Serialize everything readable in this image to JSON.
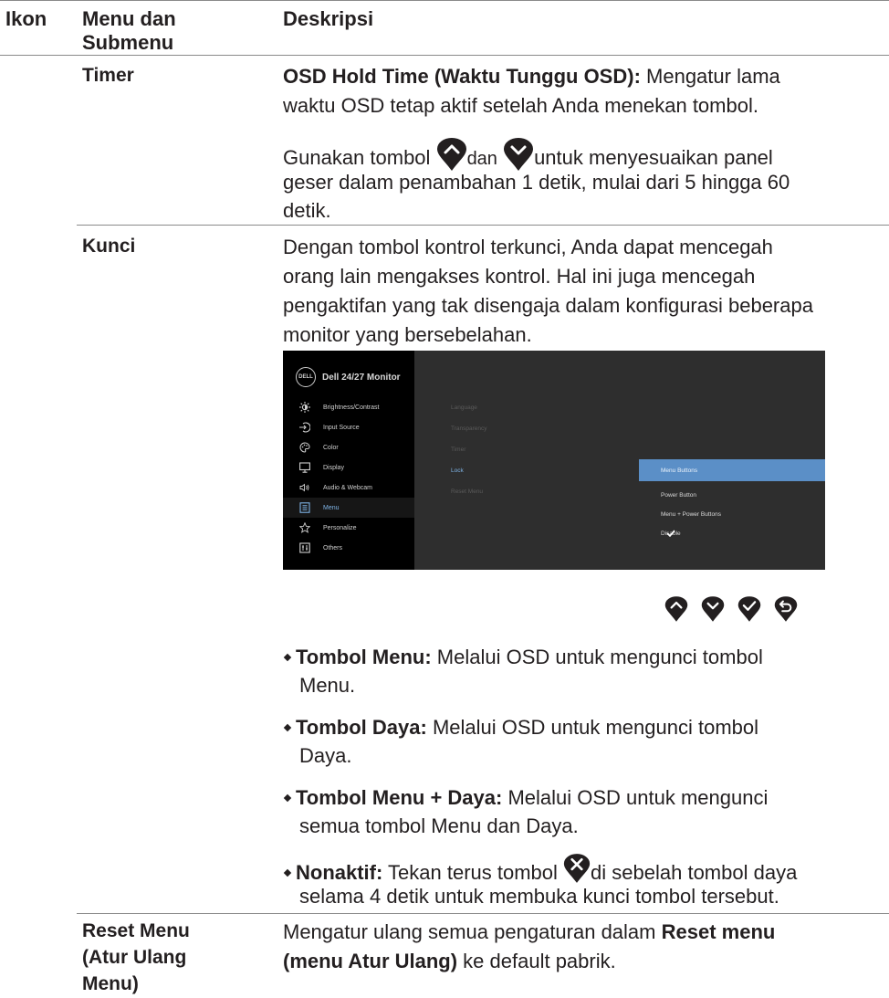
{
  "header": {
    "col_icon": "Ikon",
    "col_menu_l1": "Menu dan",
    "col_menu_l2": "Submenu",
    "col_desc": "Deskripsi"
  },
  "timer": {
    "label": "Timer",
    "p1_bold": "OSD Hold Time (Waktu Tunggu OSD):",
    "p1_a": " Mengatur lama",
    "p1_b": "waktu OSD tetap aktif setelah Anda menekan tombol.",
    "p2_a": "Gunakan tombol",
    "p2_dan": "dan",
    "p2_b": "untuk menyesuaikan panel",
    "p2_c": "geser dalam penambahan 1 detik, mulai dari 5 hingga 60",
    "p2_d": "detik."
  },
  "kunci": {
    "label": "Kunci",
    "l1": "Dengan tombol kontrol terkunci, Anda dapat mencegah",
    "l2": "orang lain mengakses kontrol. Hal ini juga mencegah",
    "l3": "pengaktifan yang tak disengaja dalam konfigurasi beberapa",
    "l4": "monitor yang bersebelahan."
  },
  "osd": {
    "logo": "DELL",
    "title": "Dell 24/27 Monitor",
    "menu": [
      {
        "label": "Brightness/Contrast",
        "icon": "sun-icon"
      },
      {
        "label": "Input Source",
        "icon": "input-icon"
      },
      {
        "label": "Color",
        "icon": "palette-icon"
      },
      {
        "label": "Display",
        "icon": "monitor-icon"
      },
      {
        "label": "Audio & Webcam",
        "icon": "speaker-icon"
      },
      {
        "label": "Menu",
        "icon": "menu-icon"
      },
      {
        "label": "Personalize",
        "icon": "star-icon"
      },
      {
        "label": "Others",
        "icon": "others-icon"
      }
    ],
    "submenu": [
      "Language",
      "Transparency",
      "Timer",
      "Lock",
      "Reset Menu"
    ],
    "options": [
      "Menu Buttons",
      "Power Button",
      "Menu + Power Buttons",
      "Disable"
    ]
  },
  "bullets": {
    "b1_bold": "Tombol Menu:",
    "b1_a": " Melalui OSD untuk mengunci tombol",
    "b1_b": "Menu.",
    "b2_bold": "Tombol Daya:",
    "b2_a": " Melalui OSD untuk mengunci tombol",
    "b2_b": "Daya.",
    "b3_bold": "Tombol Menu + Daya:",
    "b3_a": " Melalui OSD untuk mengunci",
    "b3_b": "semua tombol Menu dan Daya.",
    "b4_bold": "Nonaktif:",
    "b4_a": " Tekan terus tombol",
    "b4_b": "di sebelah tombol daya",
    "b4_c": "selama 4 detik untuk membuka kunci tombol tersebut."
  },
  "reset": {
    "label_l1": "Reset Menu",
    "label_l2": "(Atur Ulang",
    "label_l3": "Menu)",
    "d1_a": "Mengatur ulang semua pengaturan dalam ",
    "d1_bold": "Reset menu",
    "d2_bold": "(menu Atur Ulang)",
    "d2_a": " ke default pabrik."
  }
}
